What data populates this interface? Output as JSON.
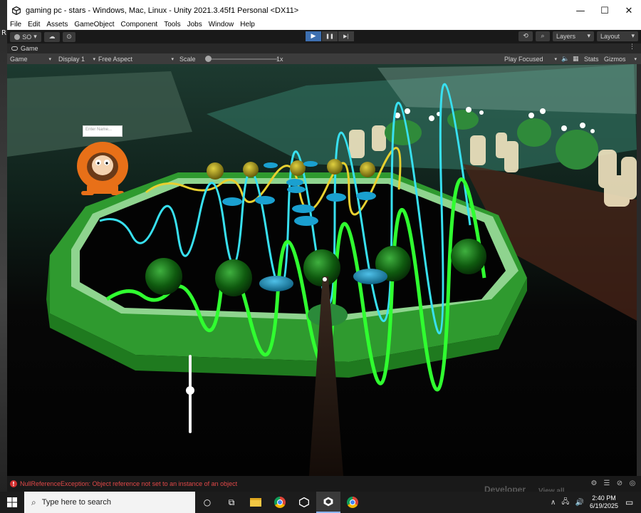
{
  "window": {
    "title": "gaming pc - stars - Windows, Mac, Linux - Unity 2021.3.45f1 Personal <DX11>",
    "minimize_glyph": "—",
    "maximize_glyph": "☐",
    "close_glyph": "✕"
  },
  "desktop": {
    "left_letter": "R"
  },
  "menu": {
    "items": [
      "File",
      "Edit",
      "Assets",
      "GameObject",
      "Component",
      "Tools",
      "Jobs",
      "Window",
      "Help"
    ]
  },
  "toolbar": {
    "account_label": "SO",
    "account_glyph": "▾",
    "cloud_glyph": "☁",
    "collab_glyph": "⊙",
    "play_glyph": "▶",
    "pause_glyph": "❚❚",
    "step_glyph": "▶|",
    "history_glyph": "⟲",
    "search_glyph": "⌕",
    "layers_label": "Layers",
    "layout_label": "Layout",
    "dropdown_arrow": "▾"
  },
  "game_tab": {
    "label": "Game",
    "kebab_glyph": "⋮"
  },
  "game_controls": {
    "mode": "Game",
    "display": "Display 1",
    "aspect": "Free Aspect",
    "scale_label": "Scale",
    "scale_value": "1x",
    "scale_fraction": 0.0,
    "play_focused": "Play Focused",
    "stats": "Stats",
    "gizmos": "Gizmos",
    "arrow": "▾",
    "audio_glyph": "🔈",
    "grid_glyph": "▦"
  },
  "game_view": {
    "name_input_placeholder": "Enter Name...",
    "slider_fraction": 0.45
  },
  "status": {
    "error_glyph": "!",
    "error_message": "NullReferenceException: Object reference not set to an instance of an object",
    "icons": [
      "⚙",
      "☰",
      "⊘",
      "◎"
    ]
  },
  "taskbar": {
    "search_glyph": "⌕",
    "search_placeholder": "Type here to search",
    "cortana_glyph": "○",
    "taskview_glyph": "⧉",
    "tray_up_glyph": "∧",
    "tray_net_glyph": "🖧",
    "tray_vol_glyph": "🔊",
    "time": "2:40 PM",
    "date": "6/19/2025",
    "notification_glyph": "▭"
  },
  "background_text": {
    "developer": "Developer",
    "view_all": "View all"
  },
  "colors": {
    "play_active": "#3d6fb0",
    "error_red": "#e04848",
    "table_rim": "#2f9a2f",
    "table_rim_light": "#8fd48f",
    "cyan_wave": "#38e0f0",
    "yellow_wave": "#e8d030",
    "green_wave": "#30ff30"
  }
}
